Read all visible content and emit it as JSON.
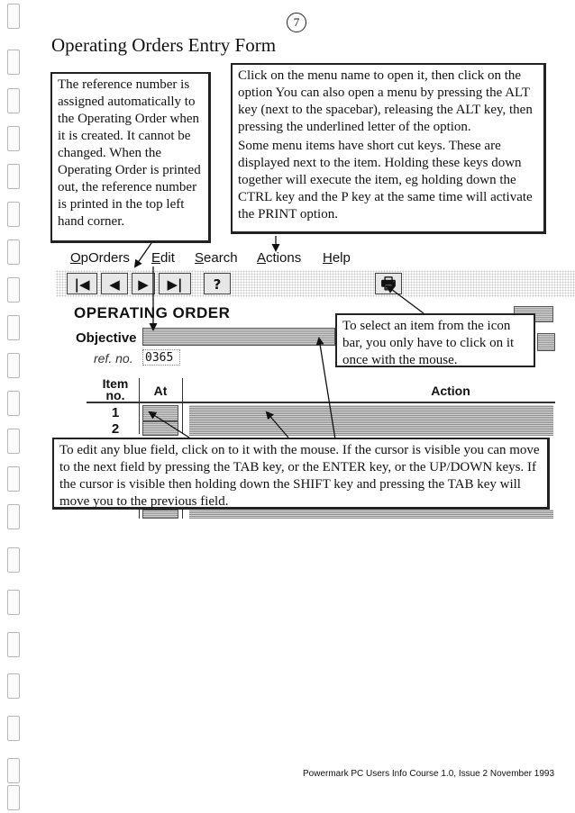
{
  "page_number": "7",
  "title": "Operating Orders Entry Form",
  "notes": {
    "reference": "The reference number is assigned automatically to the Operating Order when it is created.  It cannot be changed. When the Operating Order is printed out, the reference number is printed in the top left hand corner.",
    "menu_p1": "Click on the menu name to open it, then click on the option  You can also open a menu by pressing the ALT key (next to the spacebar), releasing the ALT key, then pressing the underlined letter of the option.",
    "menu_p2": "Some menu items have short cut keys.  These are displayed next to the item.  Holding these keys down together will execute the item, eg holding down the CTRL key and the P key at the same time will activate the PRINT option.",
    "icon_bar": "To select an item from the icon bar, you only have to click on it once with the mouse.",
    "edit": "To edit any blue field, click on to it with the mouse.  If the cursor is visible you can move to the next field by pressing the TAB key, or the ENTER key, or the UP/DOWN keys.  If the cursor is visible then holding down the SHIFT key and pressing the TAB key will move you to the previous field."
  },
  "menubar": {
    "items": [
      {
        "first": "O",
        "rest": "pOrders"
      },
      {
        "first": "E",
        "rest": "dit"
      },
      {
        "first": "S",
        "rest": "earch"
      },
      {
        "first": "A",
        "rest": "ctions"
      },
      {
        "first": "H",
        "rest": "elp"
      }
    ]
  },
  "toolbar": {
    "icons": [
      "first-record-icon",
      "previous-record-icon",
      "next-record-icon",
      "last-record-icon",
      "help-icon",
      "printer-icon"
    ],
    "first_glyph": "|◀",
    "prev_glyph": "◀",
    "next_glyph": "▶",
    "last_glyph": "▶|",
    "help_glyph": "?",
    "printer_glyph": "🖶"
  },
  "form": {
    "title": "OPERATING ORDER",
    "objective_label": "Objective",
    "ref_label": "ref. no.",
    "ref_value": "0365",
    "col_item": "Item no.",
    "col_at": "At",
    "col_action": "Action",
    "rows": [
      "1",
      "2"
    ]
  },
  "footer": "Powermark PC Users Info Course  1.0,  Issue 2   November 1993"
}
